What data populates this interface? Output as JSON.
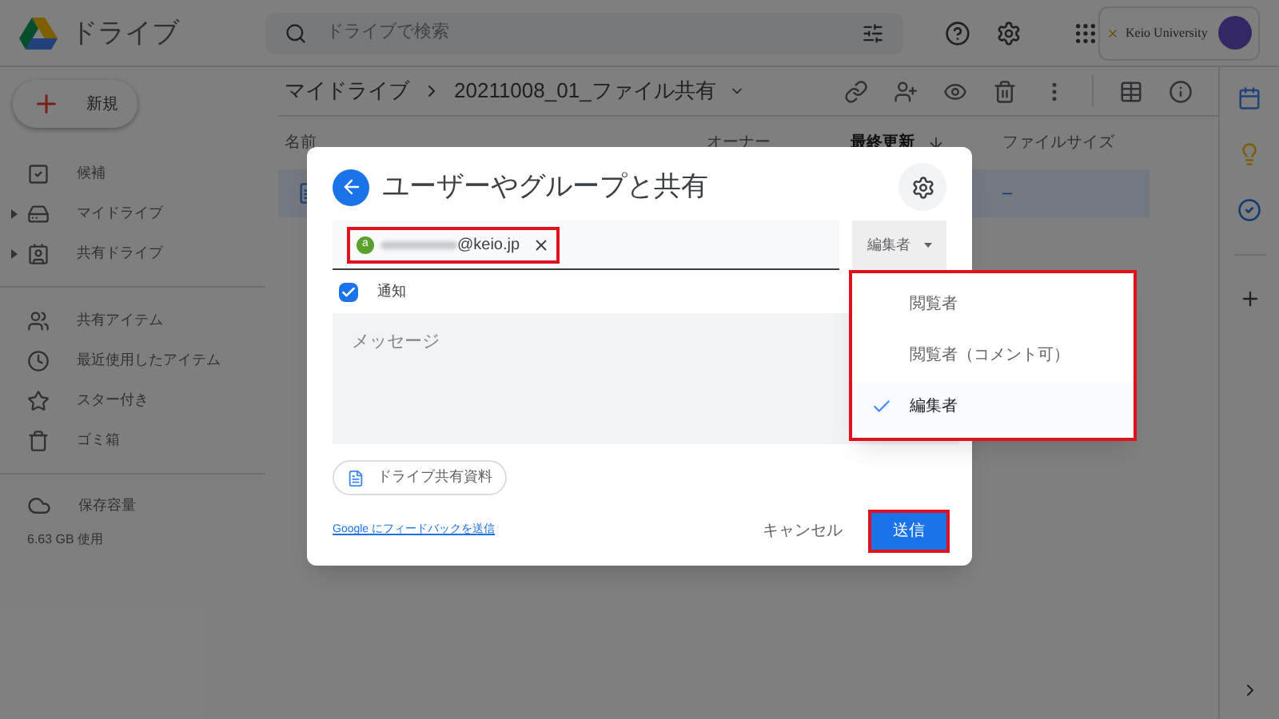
{
  "header": {
    "logo_text": "ドライブ",
    "search": {
      "placeholder": "ドライブで検索"
    },
    "account": {
      "org": "Keio University"
    }
  },
  "sidebar": {
    "new_button": "新規",
    "groups": [
      [
        {
          "label": "候補",
          "expandable": false
        },
        {
          "label": "マイドライブ",
          "expandable": true
        },
        {
          "label": "共有ドライブ",
          "expandable": true
        }
      ],
      [
        {
          "label": "共有アイテム",
          "expandable": false
        },
        {
          "label": "最近使用したアイテム",
          "expandable": false
        },
        {
          "label": "スター付き",
          "expandable": false
        },
        {
          "label": "ゴミ箱",
          "expandable": false
        }
      ]
    ],
    "storage": {
      "label": "保存容量",
      "usage": "6.63 GB 使用"
    }
  },
  "breadcrumb": [
    "マイドライブ",
    "20211008_01_ファイル共有"
  ],
  "table": {
    "columns": [
      {
        "label": "名前",
        "sorted": false
      },
      {
        "label": "オーナー",
        "sorted": false
      },
      {
        "label": "最終更新",
        "sorted": true
      },
      {
        "label": "ファイルサイズ",
        "sorted": false
      }
    ],
    "rows": [
      {
        "selected": true,
        "file_size": "–"
      }
    ]
  },
  "dialog": {
    "title": "ユーザーやグループと共有",
    "recipient": {
      "initial": "a",
      "visible_text": "@keio.jp",
      "highlighted": true
    },
    "role_button": "編集者",
    "notify": {
      "label": "通知",
      "checked": true
    },
    "message": {
      "placeholder": "メッセージ"
    },
    "attachment": "ドライブ共有資料",
    "feedback_link": "Google にフィードバックを送信",
    "cancel": "キャンセル",
    "send": {
      "label": "送信",
      "highlighted": true
    }
  },
  "role_menu": {
    "highlighted": true,
    "items": [
      {
        "label": "閲覧者",
        "selected": false
      },
      {
        "label": "閲覧者（コメント可）",
        "selected": false
      },
      {
        "label": "編集者",
        "selected": true
      }
    ]
  }
}
